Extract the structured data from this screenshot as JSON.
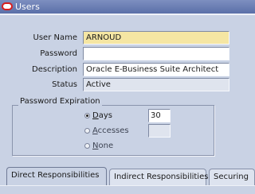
{
  "window": {
    "title": "Users",
    "app_icon": "oracle-icon"
  },
  "form": {
    "user_name": {
      "label": "User Name",
      "value": "ARNOUD"
    },
    "password": {
      "label": "Password",
      "value": ""
    },
    "description": {
      "label": "Description",
      "value": "Oracle E-Business Suite Architect"
    },
    "status": {
      "label": "Status",
      "value": "Active"
    }
  },
  "password_expiration": {
    "title": "Password Expiration",
    "options": [
      {
        "label_prefix": "",
        "label_underlined": "D",
        "label_rest": "ays",
        "selected": true,
        "value": "30"
      },
      {
        "label_prefix": "",
        "label_underlined": "A",
        "label_rest": "ccesses",
        "selected": false,
        "value": ""
      },
      {
        "label_prefix": "",
        "label_underlined": "N",
        "label_rest": "one",
        "selected": false
      }
    ]
  },
  "tabs": [
    {
      "label": "Direct Responsibilities",
      "active": true
    },
    {
      "label": "Indirect Responsibilities",
      "active": false
    },
    {
      "label": "Securing",
      "active": false
    }
  ],
  "colors": {
    "background": "#c9d2e4",
    "titlebar": "#6a7db4",
    "required_field": "#f5e6a3",
    "readonly_field": "#dfe4ee"
  }
}
